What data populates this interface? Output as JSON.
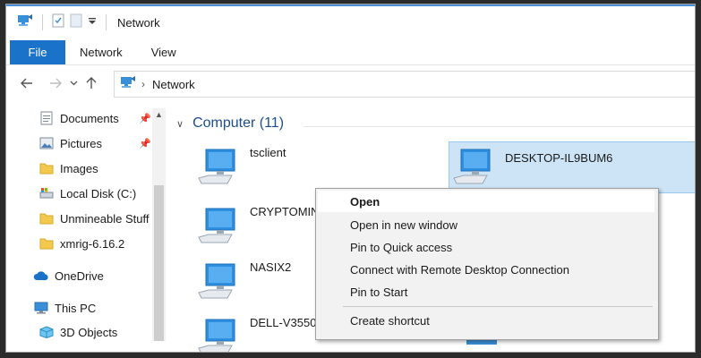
{
  "window": {
    "title": "Network"
  },
  "ribbon": {
    "tabs": [
      "File",
      "Network",
      "View"
    ]
  },
  "address": {
    "path": "Network"
  },
  "sidebar": {
    "items": [
      {
        "label": "Documents",
        "icon": "documents-icon",
        "pinned": true
      },
      {
        "label": "Pictures",
        "icon": "pictures-icon",
        "pinned": true
      },
      {
        "label": "Images",
        "icon": "folder-icon",
        "pinned": false
      },
      {
        "label": "Local Disk (C:)",
        "icon": "drive-icon",
        "pinned": false
      },
      {
        "label": "Unmineable Stuff",
        "icon": "folder-icon",
        "pinned": false
      },
      {
        "label": "xmrig-6.16.2",
        "icon": "folder-icon",
        "pinned": false
      },
      {
        "label": "OneDrive",
        "icon": "onedrive-icon",
        "pinned": false
      },
      {
        "label": "This PC",
        "icon": "pc-icon",
        "pinned": false
      },
      {
        "label": "3D Objects",
        "icon": "3d-objects-icon",
        "pinned": false
      }
    ]
  },
  "content": {
    "group_label": "Computer (11)",
    "computers": [
      "tsclient",
      "CRYPTOMINER",
      "NASIX2",
      "DELL-V3550",
      "DESKTOP-IL9BUM6"
    ],
    "selected": "DESKTOP-IL9BUM6"
  },
  "context_menu": {
    "items": [
      "Open",
      "Open in new window",
      "Pin to Quick access",
      "Connect with Remote Desktop Connection",
      "Pin to Start",
      "Create shortcut"
    ]
  },
  "colors": {
    "accent": "#1a73c8",
    "selection": "#cde4f7",
    "group_text": "#1e4e8c"
  }
}
